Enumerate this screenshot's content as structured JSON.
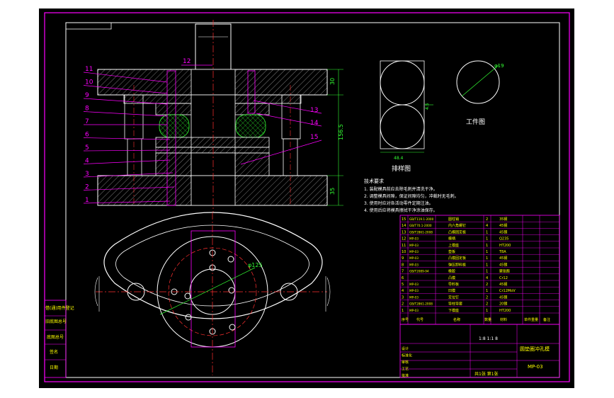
{
  "drawing": {
    "title_block": {
      "drawing_name": "圆垫圈冲孔模",
      "drawing_number": "MP-03",
      "scale": "1:1",
      "ratio_text": "1:8  1:1  8",
      "sheet_text": "共1张  第1张"
    },
    "part_numbers_left": [
      "11",
      "10",
      "9",
      "8",
      "7",
      "6",
      "5",
      "4",
      "3",
      "2",
      "1"
    ],
    "part_numbers_right": [
      "13",
      "14",
      "15"
    ],
    "part_number_top": "12",
    "dimensions": {
      "height_total": "156.5",
      "height_top": "30",
      "height_bottom": "35",
      "bolt_circle": "φ125",
      "workpiece_dia": "φ19",
      "strip_pitch": "4.5",
      "strip_width": "48.4"
    },
    "labels": {
      "strip_layout": "排样图",
      "workpiece": "工件图"
    },
    "tech_requirements": {
      "heading": "技术要求",
      "items": [
        "1. 装配模具前应去除毛刺并清洗干净。",
        "2. 调整模具间隙，保证间隙均匀，冲裁时无毛刺。",
        "3. 使用时应对各活动零件定期注油。",
        "4. 使用后应将模具擦拭干净涂油保存。"
      ]
    },
    "left_side_table": [
      "借(通)用件登记",
      "旧底图总号",
      "底图总号",
      "签名",
      "日期"
    ],
    "parts_list": [
      {
        "no": "15",
        "code": "GB/T119.1-2000",
        "name": "圆柱销",
        "qty": "2",
        "mat": "35钢"
      },
      {
        "no": "14",
        "code": "GB/T70.1-2000",
        "name": "内六角螺钉",
        "qty": "4",
        "mat": "45钢"
      },
      {
        "no": "13",
        "code": "GB/T2861-2008",
        "name": "凸模固定板",
        "qty": "1",
        "mat": "45钢"
      },
      {
        "no": "12",
        "code": "MP-03",
        "name": "模柄",
        "qty": "1",
        "mat": "Q235"
      },
      {
        "no": "11",
        "code": "MP-03",
        "name": "上模座",
        "qty": "1",
        "mat": "HT200"
      },
      {
        "no": "10",
        "code": "MP-03",
        "name": "垫板",
        "qty": "1",
        "mat": "T8A"
      },
      {
        "no": "9",
        "code": "MP-03",
        "name": "凸模固定板",
        "qty": "1",
        "mat": "45钢"
      },
      {
        "no": "8",
        "code": "MP-03",
        "name": "弹压卸料板",
        "qty": "1",
        "mat": "45钢"
      },
      {
        "no": "7",
        "code": "GB/T2089-94",
        "name": "橡胶",
        "qty": "1",
        "mat": "聚氨酯"
      },
      {
        "no": "6",
        "code": "",
        "name": "凸模",
        "qty": "4",
        "mat": "Cr12"
      },
      {
        "no": "5",
        "code": "MP-03",
        "name": "导料板",
        "qty": "2",
        "mat": "45钢"
      },
      {
        "no": "4",
        "code": "MP-03",
        "name": "凹模",
        "qty": "1",
        "mat": "Cr12MoV"
      },
      {
        "no": "3",
        "code": "MP-03",
        "name": "定位钉",
        "qty": "2",
        "mat": "45钢"
      },
      {
        "no": "2",
        "code": "GB/T2861-2008",
        "name": "导柱导套",
        "qty": "2",
        "mat": "20钢"
      },
      {
        "no": "1",
        "code": "MP-03",
        "name": "下模座",
        "qty": "1",
        "mat": "HT200"
      }
    ],
    "parts_list_header": {
      "no": "序号",
      "code": "代号",
      "name": "名称",
      "qty": "数量",
      "mat": "材料",
      "note": "单件重量",
      "total": "总重",
      "remark": "备注"
    },
    "sign_rows": [
      "设计",
      "标准化",
      "审核",
      "工艺",
      "批准"
    ]
  }
}
